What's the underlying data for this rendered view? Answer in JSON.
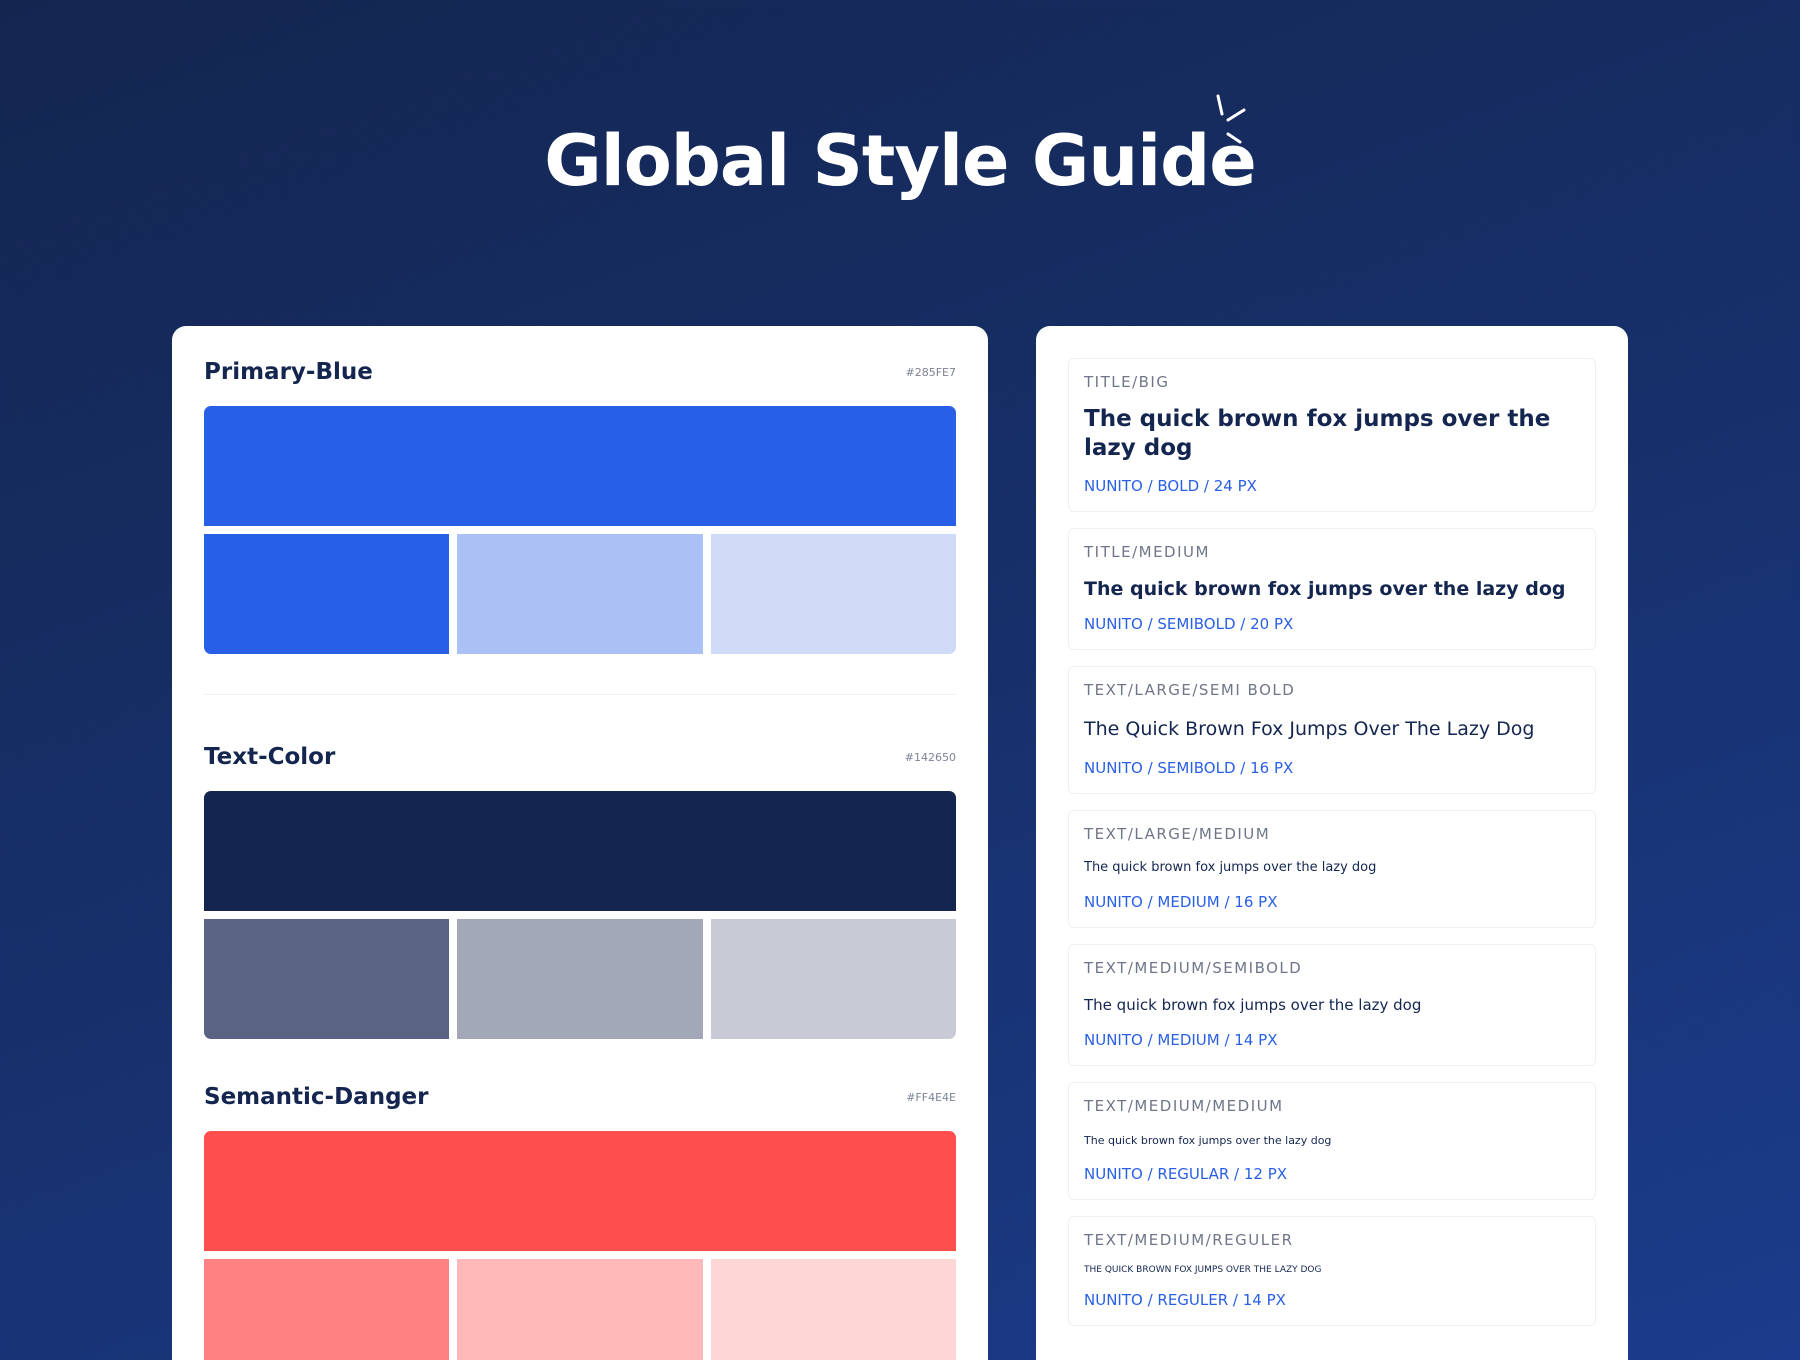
{
  "header": {
    "title": "Global Style Guide"
  },
  "colors": [
    {
      "name": "Primary-Blue",
      "hex": "#285FE7",
      "main": "#285fe7",
      "shades": [
        "#285fe7",
        "#abc0f5",
        "#d0dbf8"
      ]
    },
    {
      "name": "Text-Color",
      "hex": "#142650",
      "main": "#142650",
      "shades": [
        "#5a6482",
        "#a2a8b8",
        "#c8cbd6"
      ]
    },
    {
      "name": "Semantic-Danger",
      "hex": "#FF4E4E",
      "main": "#ff4e4e",
      "shades": [
        "#ff8181",
        "#ffb8b8",
        "#ffd6d6"
      ]
    }
  ],
  "typography": [
    {
      "label": "TITLE/BIG",
      "sample": "The quick brown fox jumps over the lazy dog",
      "spec": "NUNITO / BOLD / 24 PX"
    },
    {
      "label": "TITLE/MEDIUM",
      "sample": "The quick brown fox jumps over the lazy dog",
      "spec": "NUNITO / SEMIBOLD / 20 PX"
    },
    {
      "label": "TEXT/LARGE/SEMI BOLD",
      "sample": "The Quick Brown Fox Jumps Over The Lazy Dog",
      "spec": "NUNITO / SEMIBOLD / 16 PX"
    },
    {
      "label": "TEXT/LARGE/MEDIUM",
      "sample": "The quick brown fox jumps over the lazy dog",
      "spec": "NUNITO / MEDIUM / 16 PX"
    },
    {
      "label": "TEXT/MEDIUM/SEMIBOLD",
      "sample": "The quick brown fox jumps over the lazy dog",
      "spec": "NUNITO / MEDIUM / 14 PX"
    },
    {
      "label": "TEXT/MEDIUM/MEDIUM",
      "sample": "The quick brown fox jumps over the lazy dog",
      "spec": "NUNITO / REGULAR / 12 PX"
    },
    {
      "label": "TEXT/MEDIUM/REGULER",
      "sample": "THE QUICK BROWN FOX JUMPS OVER THE LAZY DOG",
      "spec": "NUNITO / REGULER / 14 PX"
    }
  ]
}
